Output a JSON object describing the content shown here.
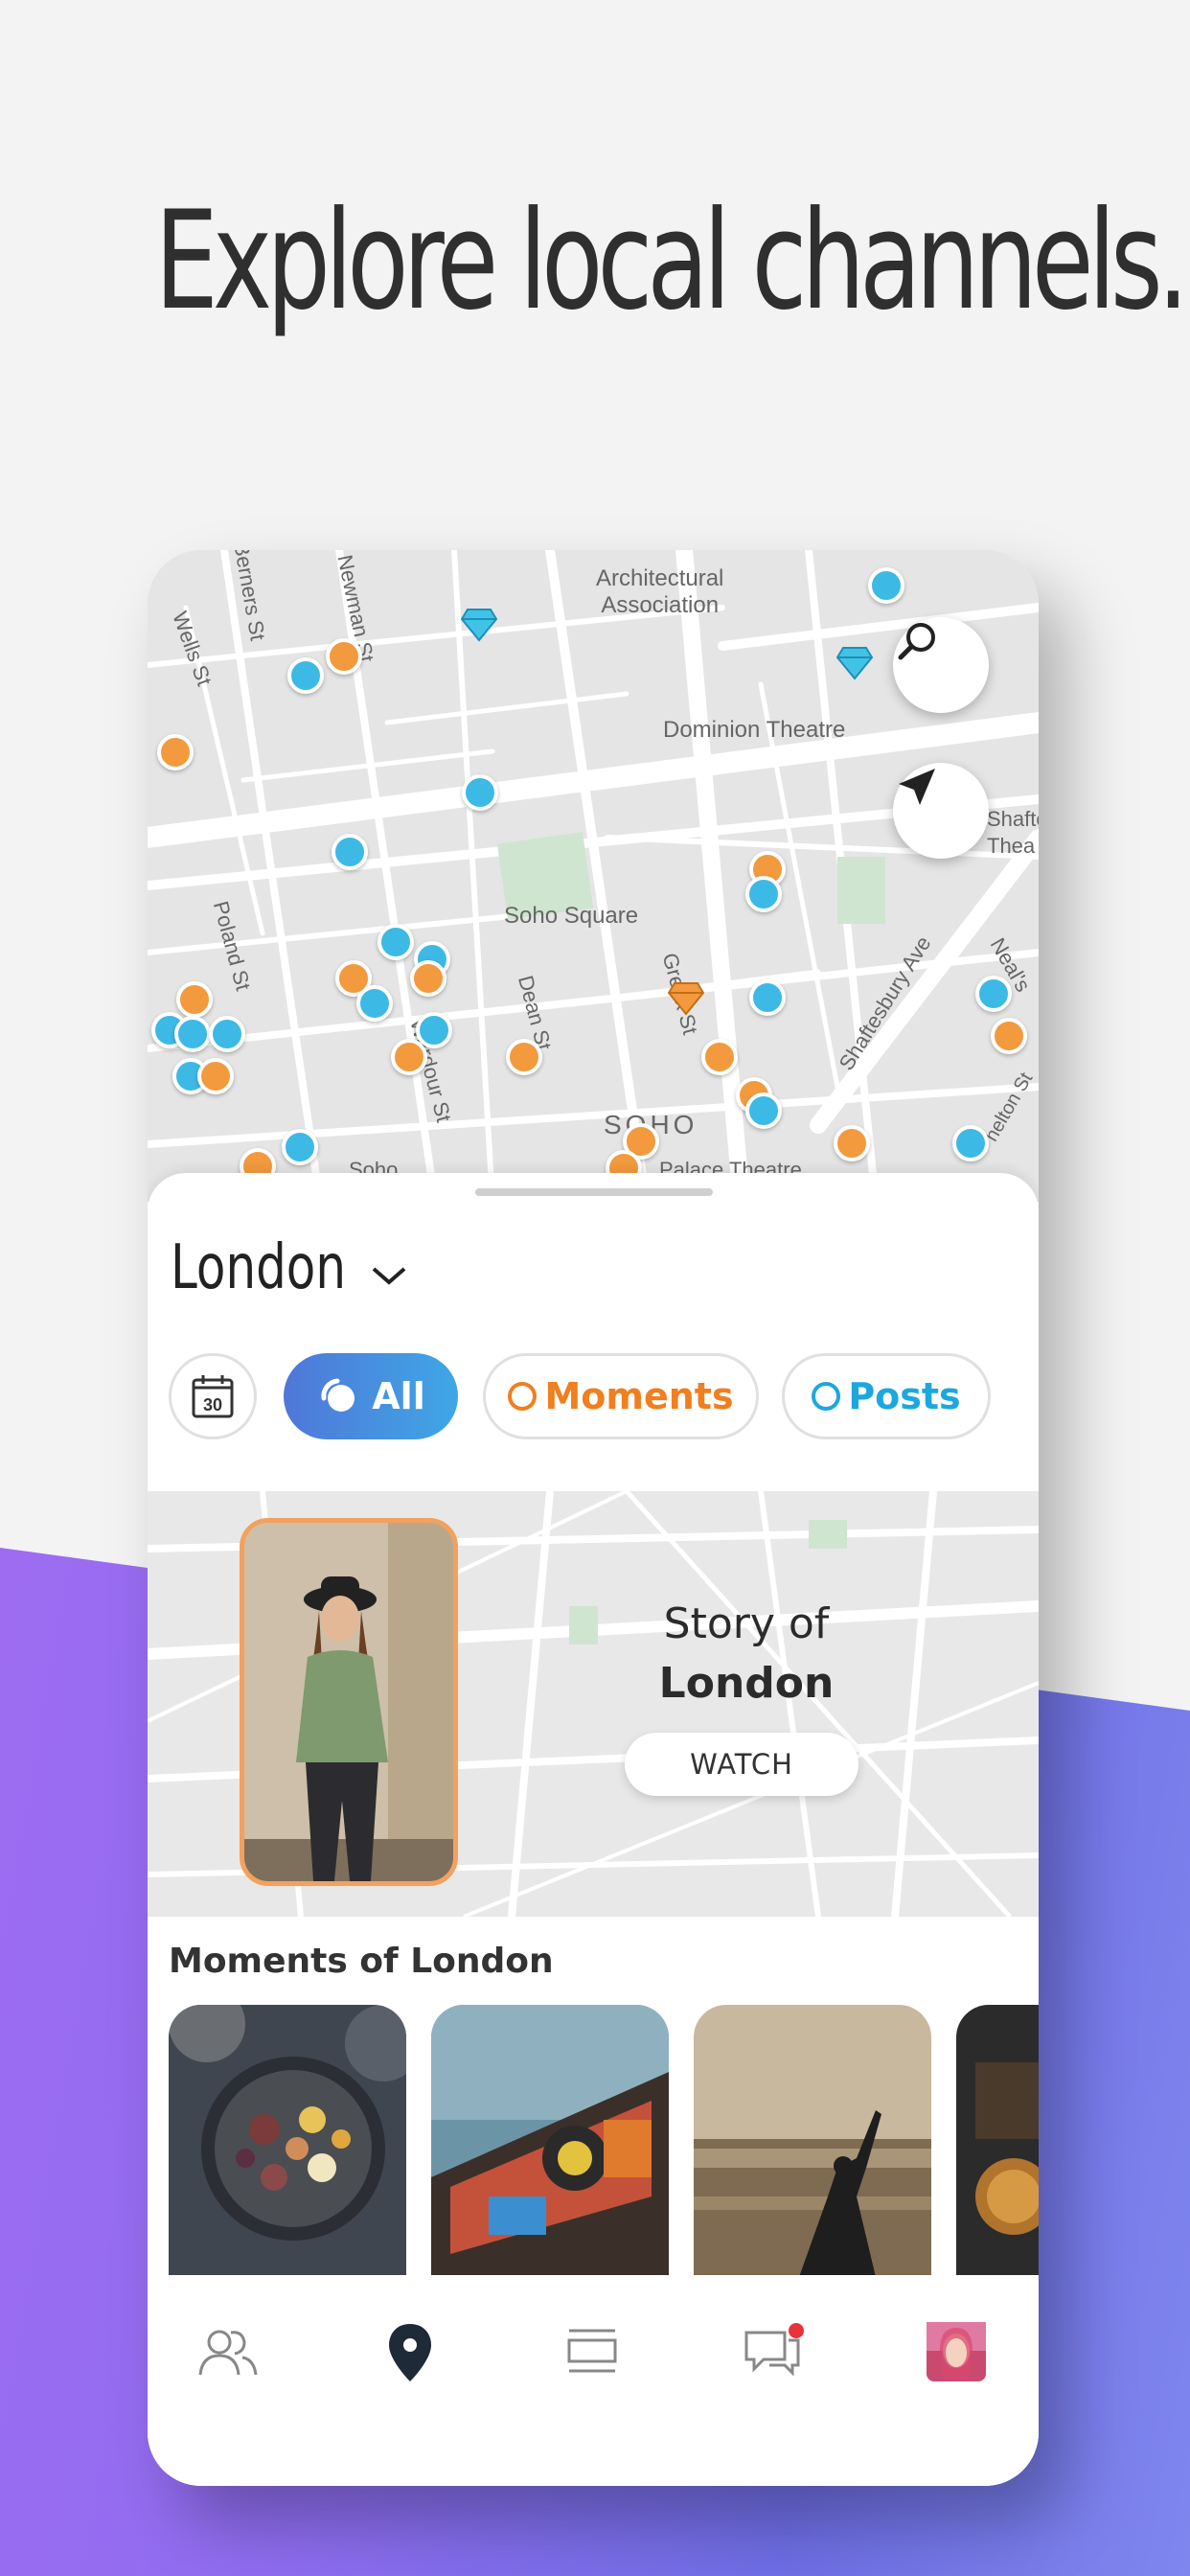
{
  "headline": "Explore local channels.",
  "map": {
    "labels": {
      "architectural": "Architectural\nAssociation",
      "dominion": "Dominion Theatre",
      "soho_square": "Soho Square",
      "soho": "SOHO",
      "berners": "Berners St",
      "newman": "Newman St",
      "wells": "Wells St",
      "poland": "Poland St",
      "dean": "Dean St",
      "greek": "Greek St",
      "wardour": "Wardour St",
      "shaftesbury": "Shaftesbury Ave",
      "neal": "Neal's",
      "shaftes": "Shaftes",
      "thea": "Thea",
      "palace": "Palace Theatre",
      "soho_small": "Soho",
      "helton": "helton St"
    },
    "search_icon": "search-icon",
    "locate_icon": "navigation-arrow-icon"
  },
  "sheet": {
    "city": "London",
    "filters": {
      "calendar_day": "30",
      "all": "All",
      "moments": "Moments",
      "posts": "Posts"
    },
    "story": {
      "title_line1": "Story of",
      "title_line2": "London",
      "watch": "WATCH"
    },
    "moments_title": "Moments of London"
  },
  "tabbar": {
    "items": [
      "people-icon",
      "map-pin-icon",
      "feed-icon",
      "chat-icon",
      "avatar"
    ]
  },
  "colors": {
    "accent_blue": "#3db9e6",
    "accent_orange": "#f39a3e",
    "purple": "#9b6bf1"
  }
}
